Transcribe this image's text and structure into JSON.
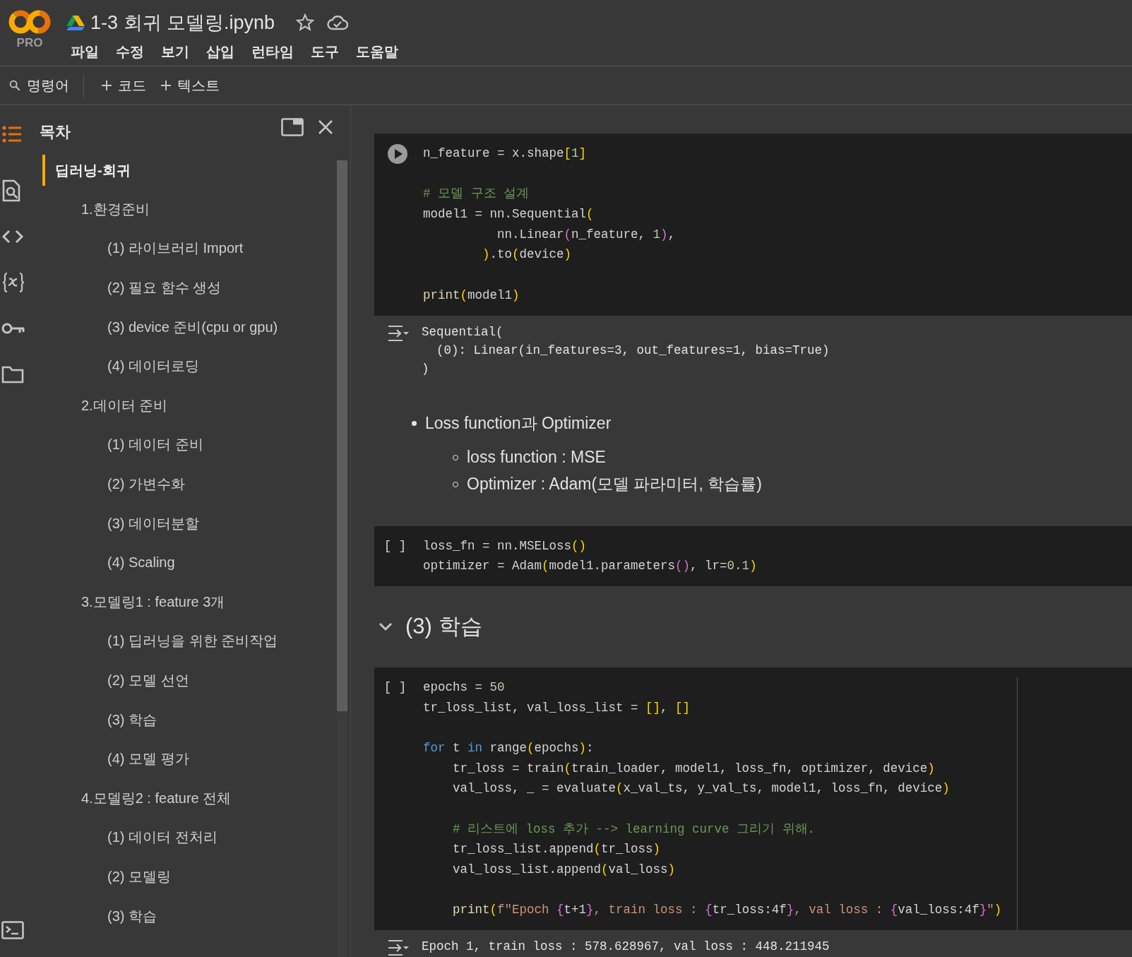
{
  "header": {
    "logo_badge": "PRO",
    "title": "1-3 회귀 모델링.ipynb",
    "menu": [
      "파일",
      "수정",
      "보기",
      "삽입",
      "런타임",
      "도구",
      "도움말"
    ]
  },
  "toolbar": {
    "command_search": "명령어",
    "buttons": [
      "코드",
      "텍스트"
    ]
  },
  "rail": [
    {
      "kind": "toc",
      "selected": true
    },
    {
      "kind": "find",
      "selected": false
    },
    {
      "kind": "code",
      "selected": false
    },
    {
      "kind": "variables",
      "selected": false
    },
    {
      "kind": "secrets",
      "selected": false
    },
    {
      "kind": "files",
      "selected": false
    }
  ],
  "rail_bottom": [
    {
      "kind": "terminal",
      "selected": false
    }
  ],
  "sidebar": {
    "title": "목차",
    "toc": [
      {
        "text": "딥러닝-회귀",
        "selected": true,
        "children": [
          {
            "text": "1.환경준비",
            "selected": false,
            "children": [
              {
                "text": "(1) 라이브러리 Import",
                "selected": false
              },
              {
                "text": "(2) 필요 함수 생성",
                "selected": false
              },
              {
                "text": "(3) device 준비(cpu or gpu)",
                "selected": false
              },
              {
                "text": "(4) 데이터로딩",
                "selected": false
              }
            ]
          },
          {
            "text": "2.데이터 준비",
            "selected": false,
            "children": [
              {
                "text": "(1) 데이터 준비",
                "selected": false
              },
              {
                "text": "(2) 가변수화",
                "selected": false
              },
              {
                "text": "(3) 데이터분할",
                "selected": false
              },
              {
                "text": "(4) Scaling",
                "selected": false
              }
            ]
          },
          {
            "text": "3.모델링1 : feature 3개",
            "selected": false,
            "children": [
              {
                "text": "(1) 딥러닝을 위한 준비작업",
                "selected": false
              },
              {
                "text": "(2) 모델 선언",
                "selected": false
              },
              {
                "text": "(3) 학습",
                "selected": false
              },
              {
                "text": "(4) 모델 평가",
                "selected": false
              }
            ]
          },
          {
            "text": "4.모델링2 : feature 전체",
            "selected": false,
            "children": [
              {
                "text": "(1) 데이터 전처리",
                "selected": false
              },
              {
                "text": "(2) 모델링",
                "selected": false
              },
              {
                "text": "(3) 학습",
                "selected": false
              }
            ]
          }
        ]
      }
    ]
  },
  "notebook": [
    {
      "kind": "code",
      "run_button": true,
      "ruler": false,
      "blocks": [
        [
          [
            {
              "kind": "plain",
              "text": "n_feature = x.shape"
            },
            {
              "kind": "bracket",
              "text": "["
            },
            {
              "kind": "number",
              "text": "1"
            },
            {
              "kind": "bracket",
              "text": "]"
            }
          ]
        ],
        [
          [
            {
              "kind": "comment",
              "text": "# 모델 구조 설계"
            }
          ],
          [
            {
              "kind": "plain",
              "text": "model1 = nn.Sequential"
            },
            {
              "kind": "bracket",
              "text": "("
            }
          ],
          [
            {
              "kind": "plain",
              "text": "          nn.Linear"
            },
            {
              "kind": "bracket2",
              "text": "("
            },
            {
              "kind": "plain",
              "text": "n_feature, "
            },
            {
              "kind": "number",
              "text": "1"
            },
            {
              "kind": "bracket2",
              "text": ")"
            },
            {
              "kind": "plain",
              "text": ","
            }
          ],
          [
            {
              "kind": "bracket",
              "text": "        )"
            },
            {
              "kind": "plain",
              "text": ".to"
            },
            {
              "kind": "bracket",
              "text": "("
            },
            {
              "kind": "plain",
              "text": "device"
            },
            {
              "kind": "bracket",
              "text": ")"
            }
          ]
        ],
        [
          [
            {
              "kind": "function",
              "text": "print"
            },
            {
              "kind": "bracket",
              "text": "("
            },
            {
              "kind": "plain",
              "text": "model1"
            },
            {
              "kind": "bracket",
              "text": ")"
            }
          ]
        ]
      ]
    },
    {
      "kind": "output",
      "lines": [
        "Sequential(",
        "  (0): Linear(in_features=3, out_features=1, bias=True)",
        ")"
      ]
    },
    {
      "kind": "markdown",
      "bullets": [
        {
          "text": "Loss function과 Optimizer",
          "children": [
            {
              "text": "loss function : MSE"
            },
            {
              "text": "Optimizer : Adam(모델 파라미터, 학습률)"
            }
          ]
        }
      ]
    },
    {
      "kind": "code",
      "run_button": false,
      "prompt": "[ ]",
      "ruler": false,
      "blocks": [
        [
          [
            {
              "kind": "plain",
              "text": "loss_fn = nn.MSELoss"
            },
            {
              "kind": "bracket",
              "text": "()"
            }
          ],
          [
            {
              "kind": "plain",
              "text": "optimizer = Adam"
            },
            {
              "kind": "bracket",
              "text": "("
            },
            {
              "kind": "plain",
              "text": "model1.parameters"
            },
            {
              "kind": "bracket2",
              "text": "()"
            },
            {
              "kind": "plain",
              "text": ", lr="
            },
            {
              "kind": "number",
              "text": "0.1"
            },
            {
              "kind": "bracket",
              "text": ")"
            }
          ]
        ]
      ]
    },
    {
      "kind": "heading",
      "expanded": true,
      "text": "(3) 학습"
    },
    {
      "kind": "code",
      "run_button": false,
      "prompt": "[ ]",
      "ruler": true,
      "blocks": [
        [
          [
            {
              "kind": "plain",
              "text": "epochs = "
            },
            {
              "kind": "number",
              "text": "50"
            }
          ],
          [
            {
              "kind": "plain",
              "text": "tr_loss_list, val_loss_list = "
            },
            {
              "kind": "bracket",
              "text": "[]"
            },
            {
              "kind": "plain",
              "text": ", "
            },
            {
              "kind": "bracket",
              "text": "[]"
            }
          ]
        ],
        [
          [
            {
              "kind": "keyword",
              "text": "for"
            },
            {
              "kind": "plain",
              "text": " t "
            },
            {
              "kind": "keyword",
              "text": "in"
            },
            {
              "kind": "plain",
              "text": " range"
            },
            {
              "kind": "bracket",
              "text": "("
            },
            {
              "kind": "plain",
              "text": "epochs"
            },
            {
              "kind": "bracket",
              "text": ")"
            },
            {
              "kind": "plain",
              "text": ":"
            }
          ],
          [
            {
              "kind": "plain",
              "text": "    tr_loss = train"
            },
            {
              "kind": "bracket",
              "text": "("
            },
            {
              "kind": "plain",
              "text": "train_loader, model1, loss_fn, optimizer, device"
            },
            {
              "kind": "bracket",
              "text": ")"
            }
          ],
          [
            {
              "kind": "plain",
              "text": "    val_loss, _ = evaluate"
            },
            {
              "kind": "bracket",
              "text": "("
            },
            {
              "kind": "plain",
              "text": "x_val_ts, y_val_ts, model1, loss_fn, device"
            },
            {
              "kind": "bracket",
              "text": ")"
            }
          ]
        ],
        [
          [
            {
              "kind": "comment",
              "text": "    # 리스트에 loss 추가 --> learning curve 그리기 위해."
            }
          ],
          [
            {
              "kind": "plain",
              "text": "    tr_loss_list.append"
            },
            {
              "kind": "bracket",
              "text": "("
            },
            {
              "kind": "plain",
              "text": "tr_loss"
            },
            {
              "kind": "bracket",
              "text": ")"
            }
          ],
          [
            {
              "kind": "plain",
              "text": "    val_loss_list.append"
            },
            {
              "kind": "bracket",
              "text": "("
            },
            {
              "kind": "plain",
              "text": "val_loss"
            },
            {
              "kind": "bracket",
              "text": ")"
            }
          ]
        ],
        [
          [
            {
              "kind": "function",
              "text": "    print"
            },
            {
              "kind": "bracket",
              "text": "("
            },
            {
              "kind": "string",
              "text": "f\"Epoch "
            },
            {
              "kind": "bracket2",
              "text": "{"
            },
            {
              "kind": "plain",
              "text": "t+1"
            },
            {
              "kind": "bracket2",
              "text": "}"
            },
            {
              "kind": "string",
              "text": ", train loss : "
            },
            {
              "kind": "bracket2",
              "text": "{"
            },
            {
              "kind": "plain",
              "text": "tr_loss:4f"
            },
            {
              "kind": "bracket2",
              "text": "}"
            },
            {
              "kind": "string",
              "text": ", val loss : "
            },
            {
              "kind": "bracket2",
              "text": "{"
            },
            {
              "kind": "plain",
              "text": "val_loss:4f"
            },
            {
              "kind": "bracket2",
              "text": "}"
            },
            {
              "kind": "string",
              "text": "\""
            },
            {
              "kind": "bracket",
              "text": ")"
            }
          ]
        ]
      ]
    },
    {
      "kind": "output",
      "lines": [
        "Epoch 1, train loss : 578.628967, val loss : 448.211945"
      ]
    }
  ]
}
